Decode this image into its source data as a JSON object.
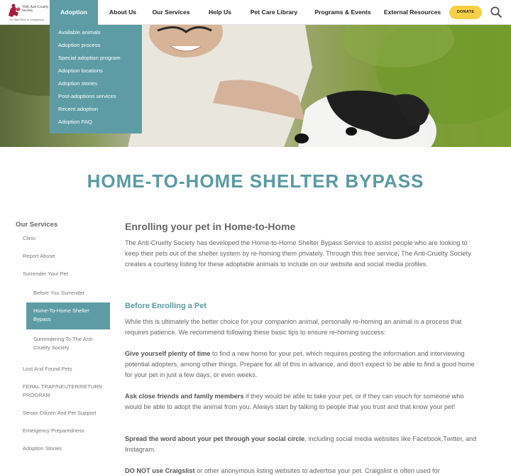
{
  "header": {
    "logo_name": "THE Anti-Cruelty Society",
    "logo_tagline": "An Open Door to Compassion",
    "nav": [
      "Adoption",
      "About Us",
      "Our Services",
      "Help Us",
      "Pet Care Library",
      "Programs & Events",
      "External Resources"
    ],
    "donate_label": "DONATE"
  },
  "dropdown": {
    "items": [
      "Available animals",
      "Adoption process",
      "Special adoption program",
      "Adoption locations",
      "Adoption stories",
      "Post-adoptions services",
      "Recent adoption",
      "Adoption FAQ"
    ]
  },
  "page": {
    "title": "HOME-TO-HOME SHELTER BYPASS"
  },
  "sidebar": {
    "heading": "Our Services",
    "items": [
      "Clinic",
      "Report Abuse",
      "Surrender Your Pet",
      "Before You Surrender",
      "Home-To-Home Shelter Bypass",
      "Surrendering To The Anti-Cruelty Society",
      "Lost And Found Pets",
      "FERAL TRAP/NEUTER/RETURN PROGRAM",
      "Senior Citizen And Pet Support",
      "Emergency Preparedness",
      "Adoption Stories"
    ]
  },
  "content": {
    "h2": "Enrolling your pet in Home-to-Home",
    "intro": "The Anti-Cruelty Society has developed the Home-to-Home Shelter Bypass Service to assist people who are looking to keep their pets out of the shelter system by re-homing them privately. Through this free service, The Anti-Cruelty Society creates a courtesy listing for these adoptable animals to include on our website and social media profiles.",
    "h3": "Before Enrolling a Pet",
    "lead": "While this is ultimately the better choice for your companion animal, personally re-homing an animal is a process that requires patience. We recommend following these basic tips to ensure re-homing success:",
    "tips": [
      {
        "bold": "Give yourself plenty of time",
        "text": " to find a new home for your pet, which requires posting the information and interviewing potential adopters, among other things. Prepare for all of this in advance, and don't expect to be able to find a good home for your pet in just a few days, or even weeks."
      },
      {
        "bold": "Ask close friends and family members",
        "text": " if they would be able to take your pet, or if they can vouch for someone who would be able to adopt the animal from you. Always start by talking to people that you trust and that know your pet!"
      },
      {
        "bold": "Spread the word about your pet through your social circle",
        "text": ", including social media websites like Facebook,Twitter, and Instagram."
      },
      {
        "bold": "DO NOT use Craigslist",
        "text": " or other anonymous listing websites to advertise your pet. Craigslist is often used for"
      }
    ]
  }
}
